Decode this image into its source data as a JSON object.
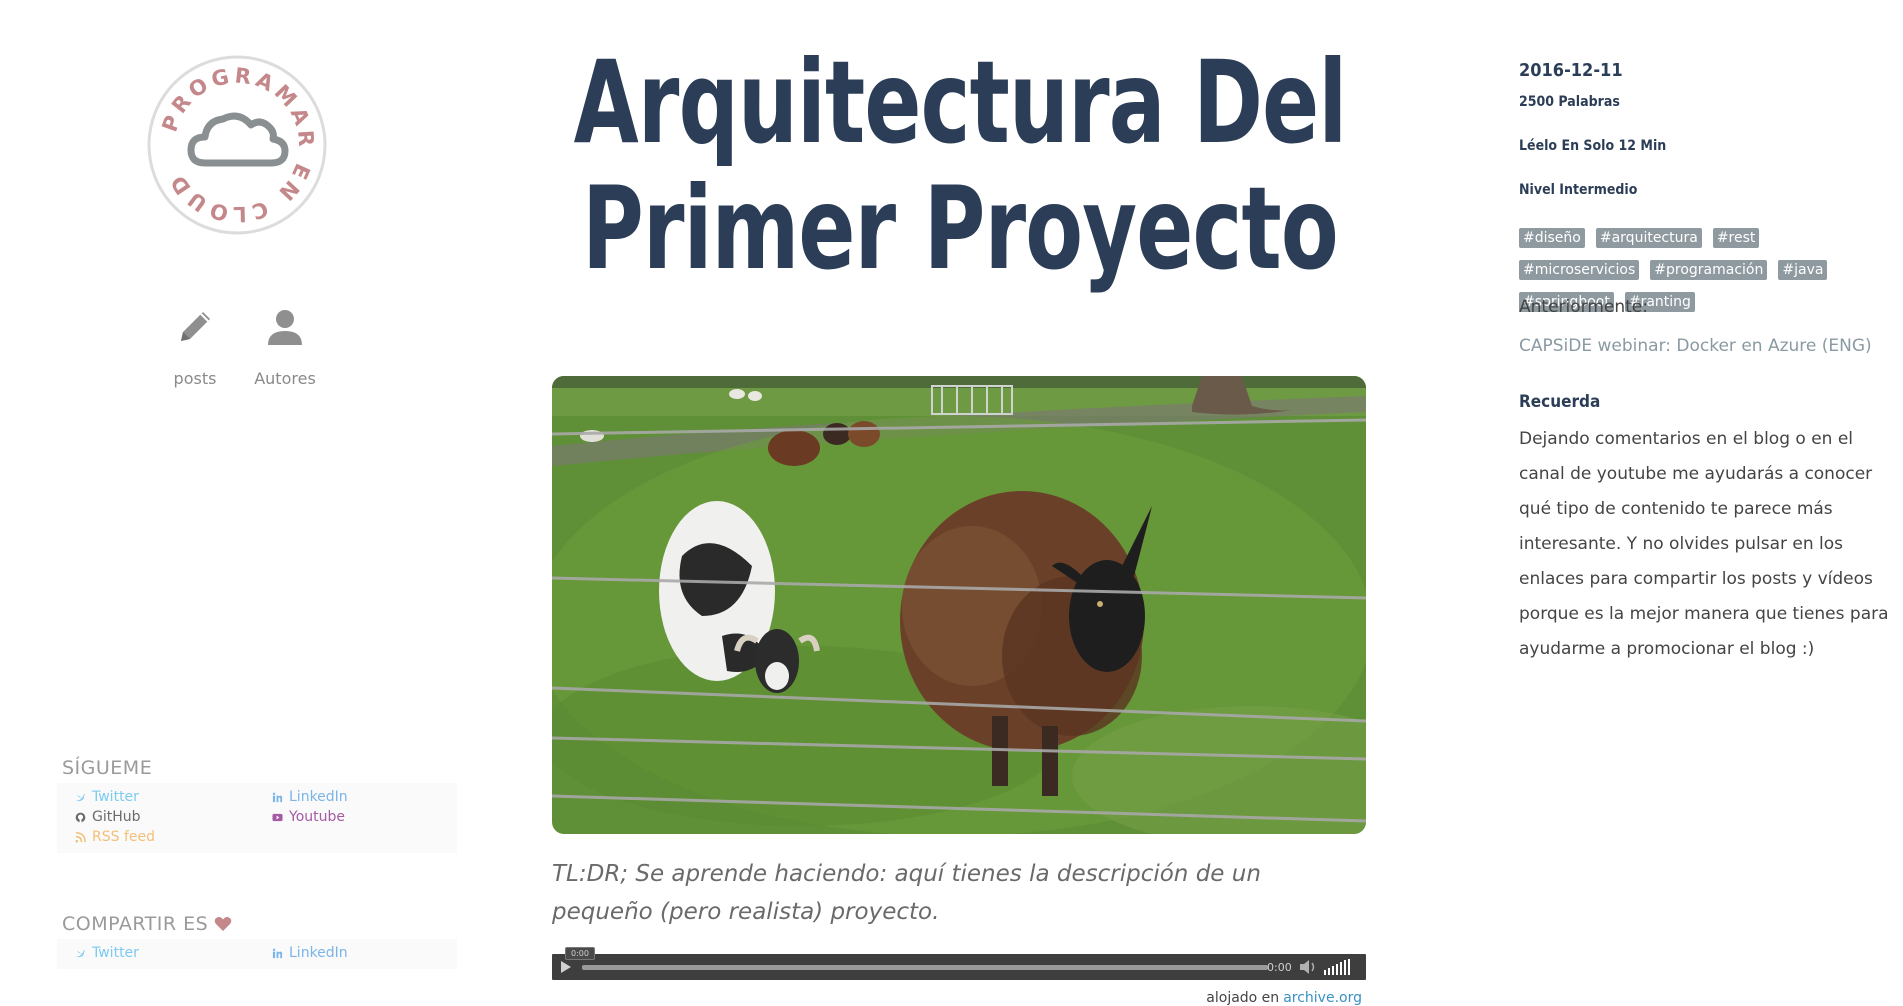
{
  "logo": {
    "text": "PROGRAMAR EN CLOUD"
  },
  "nav": {
    "posts": "posts",
    "authors": "Autores"
  },
  "follow": {
    "title": "SÍGUEME",
    "twitter": "Twitter",
    "linkedin": "LinkedIn",
    "github": "GitHub",
    "youtube": "Youtube",
    "rss": "RSS feed"
  },
  "share": {
    "title": "COMPARTIR ES",
    "twitter": "Twitter",
    "linkedin": "LinkedIn"
  },
  "post": {
    "title": "Arquitectura Del Primer Proyecto",
    "tldr": "TL:DR; Se aprende haciendo: aquí tienes la descripción de un pequeño (pero realista) proyecto."
  },
  "audio": {
    "bubble_time": "0:00",
    "time": "0:00",
    "hosted_label": "alojado en",
    "hosted_link": "archive.org"
  },
  "meta": {
    "date": "2016-12-11",
    "words": "2500 Palabras",
    "read_time": "Léelo En Solo 12 Min",
    "level": "Nivel Intermedio",
    "tags": [
      "#diseño",
      "#arquitectura",
      "#rest",
      "#microservicios",
      "#programación",
      "#java",
      "#springboot",
      "#ranting"
    ],
    "previous_label": "Anteriormente:",
    "previous_link": "CAPSiDE webinar: Docker en Azure (ENG)",
    "remember_title": "Recuerda",
    "remember_text": "Dejando comentarios en el blog o en el canal de youtube me ayudarás a conocer qué tipo de contenido te parece más interesante. Y no olvides pulsar en los enlaces para compartir los posts y vídeos porque es la mejor manera que tienes para ayudarme a promocionar el blog :)"
  },
  "colors": {
    "title": "#2c3e57",
    "logo": "#c4878a",
    "tag_bg": "#8f9aa0"
  }
}
